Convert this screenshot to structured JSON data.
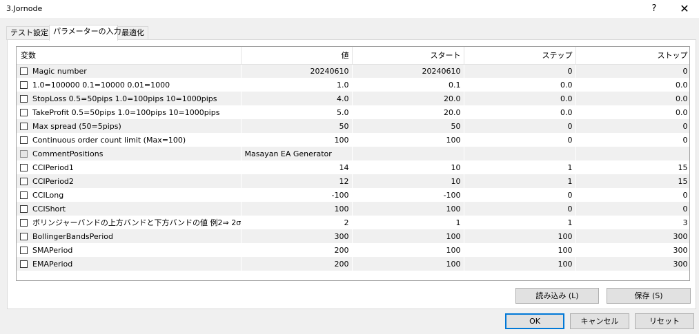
{
  "window": {
    "title": "3.Jornode",
    "help_label": "?",
    "close_label": "✕"
  },
  "tabs": [
    {
      "label": "テスト設定",
      "active": false
    },
    {
      "label": "パラメーターの入力",
      "active": true
    },
    {
      "label": "最適化",
      "active": false
    }
  ],
  "grid": {
    "headers": [
      "変数",
      "値",
      "スタート",
      "ステップ",
      "ストップ"
    ],
    "rows": [
      {
        "name": "Magic number",
        "value": "20240610",
        "start": "20240610",
        "step": "0",
        "stop": "0"
      },
      {
        "name": "1.0=100000 0.1=10000 0.01=1000",
        "value": "1.0",
        "start": "0.1",
        "step": "0.0",
        "stop": "0.0"
      },
      {
        "name": "StopLoss 0.5=50pips 1.0=100pips 10=1000pips",
        "value": "4.0",
        "start": "20.0",
        "step": "0.0",
        "stop": "0.0"
      },
      {
        "name": "TakeProfit 0.5=50pips 1.0=100pips 10=1000pips",
        "value": "5.0",
        "start": "20.0",
        "step": "0.0",
        "stop": "0.0"
      },
      {
        "name": "Max spread (50=5pips)",
        "value": "50",
        "start": "50",
        "step": "0",
        "stop": "0"
      },
      {
        "name": "Continuous order count limit (Max=100)",
        "value": "100",
        "start": "100",
        "step": "0",
        "stop": "0"
      },
      {
        "name": "CommentPositions",
        "value": "Masayan EA Generator",
        "start": "",
        "step": "",
        "stop": "",
        "text_value": true
      },
      {
        "name": "CCIPeriod1",
        "value": "14",
        "start": "10",
        "step": "1",
        "stop": "15"
      },
      {
        "name": "CCIPeriod2",
        "value": "12",
        "start": "10",
        "step": "1",
        "stop": "15"
      },
      {
        "name": "CCILong",
        "value": "-100",
        "start": "-100",
        "step": "0",
        "stop": "0"
      },
      {
        "name": "CCIShort",
        "value": "100",
        "start": "100",
        "step": "0",
        "stop": "0"
      },
      {
        "name": "ボリンジャーバンドの上方バンドと下方バンドの値 例2⇒ 2σ（...",
        "value": "2",
        "start": "1",
        "step": "1",
        "stop": "3"
      },
      {
        "name": "BollingerBandsPeriod",
        "value": "300",
        "start": "100",
        "step": "100",
        "stop": "300"
      },
      {
        "name": "SMAPeriod",
        "value": "200",
        "start": "100",
        "step": "100",
        "stop": "300"
      },
      {
        "name": "EMAPeriod",
        "value": "200",
        "start": "100",
        "step": "100",
        "stop": "300"
      }
    ]
  },
  "buttons": {
    "load": "読み込み (L)",
    "save": "保存 (S)",
    "ok": "OK",
    "cancel": "キャンセル",
    "reset": "リセット"
  }
}
